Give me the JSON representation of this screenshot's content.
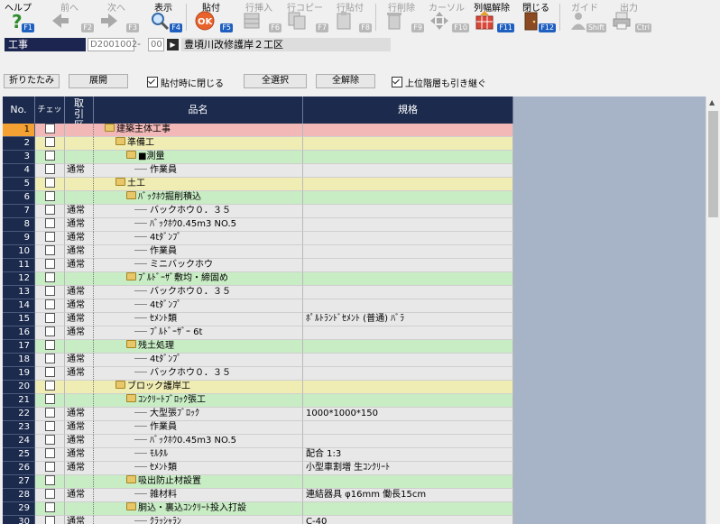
{
  "toolbar": {
    "help": {
      "label": "ヘルプ",
      "fkey": "F1"
    },
    "prev": {
      "label": "前へ",
      "fkey": "F2"
    },
    "next": {
      "label": "次へ",
      "fkey": "F3"
    },
    "view": {
      "label": "表示",
      "fkey": "F4"
    },
    "paste": {
      "label": "貼付",
      "fkey": "F5"
    },
    "row_insert": {
      "label": "行挿入",
      "fkey": "F6"
    },
    "row_copy": {
      "label": "行コピー",
      "fkey": "F7"
    },
    "row_paste": {
      "label": "行貼付",
      "fkey": "F8"
    },
    "row_delete": {
      "label": "行削除",
      "fkey": "F9"
    },
    "cursor": {
      "label": "カーソル",
      "fkey": "F10"
    },
    "col_width_reset": {
      "label": "列幅解除",
      "fkey": "F11"
    },
    "close": {
      "label": "閉じる",
      "fkey": "F12"
    },
    "guide": {
      "label": "ガイド",
      "fkey": "Shift"
    },
    "output": {
      "label": "出力",
      "fkey": "Ctrl"
    }
  },
  "project": {
    "kind": "工事",
    "code": "D2001002",
    "dash": "-",
    "sub": "00",
    "name": "豊頃川改修護岸２工区"
  },
  "controls": {
    "collapse": "折りたたみ",
    "expand": "展開",
    "close_on_paste": "貼付時に閉じる",
    "select_all": "全選択",
    "deselect_all": "全解除",
    "inherit_upper": "上位階層も引き継ぐ"
  },
  "grid": {
    "headers": {
      "no": "No.",
      "check": "チェック",
      "kbn": "取引区分",
      "name": "品名",
      "spec": "規格"
    },
    "colors": {
      "level0": "#f2b8b8",
      "level1": "#f0edb4",
      "level2": "#c8ecc4",
      "item": "#e8e8e8"
    },
    "rows": [
      {
        "no": "1",
        "kbn": "",
        "name": "建築主体工事",
        "spec": "",
        "level": 0,
        "folder": true
      },
      {
        "no": "2",
        "kbn": "",
        "name": "準備工",
        "spec": "",
        "level": 1,
        "folder": true
      },
      {
        "no": "3",
        "kbn": "",
        "name": "■測量",
        "spec": "",
        "level": 2,
        "folder": true
      },
      {
        "no": "4",
        "kbn": "通常",
        "name": "作業員",
        "spec": "",
        "level": 3,
        "folder": false
      },
      {
        "no": "5",
        "kbn": "",
        "name": "土工",
        "spec": "",
        "level": 1,
        "folder": true
      },
      {
        "no": "6",
        "kbn": "",
        "name": "ﾊﾞｯｸﾎｳ掘削積込",
        "spec": "",
        "level": 2,
        "folder": true
      },
      {
        "no": "7",
        "kbn": "通常",
        "name": "バックホウ０．３５",
        "spec": "",
        "level": 3,
        "folder": false
      },
      {
        "no": "8",
        "kbn": "通常",
        "name": "ﾊﾞｯｸﾎｳ0.45m3         NO.5",
        "spec": "",
        "level": 3,
        "folder": false
      },
      {
        "no": "9",
        "kbn": "通常",
        "name": "4tﾀﾞﾝﾌﾟ",
        "spec": "",
        "level": 3,
        "folder": false
      },
      {
        "no": "10",
        "kbn": "通常",
        "name": "作業員",
        "spec": "",
        "level": 3,
        "folder": false
      },
      {
        "no": "11",
        "kbn": "通常",
        "name": "ミニバックホウ",
        "spec": "",
        "level": 3,
        "folder": false
      },
      {
        "no": "12",
        "kbn": "",
        "name": "ﾌﾞﾙﾄﾞｰｻﾞ敷均・締固め",
        "spec": "",
        "level": 2,
        "folder": true
      },
      {
        "no": "13",
        "kbn": "通常",
        "name": "バックホウ０．３５",
        "spec": "",
        "level": 3,
        "folder": false
      },
      {
        "no": "14",
        "kbn": "通常",
        "name": "4tﾀﾞﾝﾌﾟ",
        "spec": "",
        "level": 3,
        "folder": false
      },
      {
        "no": "15",
        "kbn": "通常",
        "name": "ｾﾒﾝﾄ類",
        "spec": "ﾎﾟﾙﾄﾗﾝﾄﾞｾﾒﾝﾄ (普通) ﾊﾞﾗ",
        "level": 3,
        "folder": false
      },
      {
        "no": "16",
        "kbn": "通常",
        "name": "ﾌﾞﾙﾄﾞｰｻﾞｰ 6t",
        "spec": "",
        "level": 3,
        "folder": false
      },
      {
        "no": "17",
        "kbn": "",
        "name": "残土処理",
        "spec": "",
        "level": 2,
        "folder": true
      },
      {
        "no": "18",
        "kbn": "通常",
        "name": "4tﾀﾞﾝﾌﾟ",
        "spec": "",
        "level": 3,
        "folder": false
      },
      {
        "no": "19",
        "kbn": "通常",
        "name": "バックホウ０．３５",
        "spec": "",
        "level": 3,
        "folder": false
      },
      {
        "no": "20",
        "kbn": "",
        "name": "ブロック護岸工",
        "spec": "",
        "level": 1,
        "folder": true
      },
      {
        "no": "21",
        "kbn": "",
        "name": "ｺﾝｸﾘｰﾄﾌﾞﾛｯｸ張工",
        "spec": "",
        "level": 2,
        "folder": true
      },
      {
        "no": "22",
        "kbn": "通常",
        "name": "大型張ﾌﾞﾛｯｸ",
        "spec": "1000*1000*150",
        "level": 3,
        "folder": false
      },
      {
        "no": "23",
        "kbn": "通常",
        "name": "作業員",
        "spec": "",
        "level": 3,
        "folder": false
      },
      {
        "no": "24",
        "kbn": "通常",
        "name": "ﾊﾞｯｸﾎｳ0.45m3         NO.5",
        "spec": "",
        "level": 3,
        "folder": false
      },
      {
        "no": "25",
        "kbn": "通常",
        "name": "ﾓﾙﾀﾙ",
        "spec": "配合 1:3",
        "level": 3,
        "folder": false
      },
      {
        "no": "26",
        "kbn": "通常",
        "name": "ｾﾒﾝﾄ類",
        "spec": "小型車割増  生ｺﾝｸﾘｰﾄ",
        "level": 3,
        "folder": false
      },
      {
        "no": "27",
        "kbn": "",
        "name": "吸出防止材設置",
        "spec": "",
        "level": 2,
        "folder": true
      },
      {
        "no": "28",
        "kbn": "通常",
        "name": "雑材料",
        "spec": "連結器具  φ16mm  働長15cm",
        "level": 3,
        "folder": false
      },
      {
        "no": "29",
        "kbn": "",
        "name": "胴込・裏込ｺﾝｸﾘｰﾄ投入打設",
        "spec": "",
        "level": 2,
        "folder": true
      },
      {
        "no": "30",
        "kbn": "通常",
        "name": "ｸﾗｯｼｬﾗﾝ",
        "spec": "C-40",
        "level": 3,
        "folder": false
      }
    ]
  }
}
